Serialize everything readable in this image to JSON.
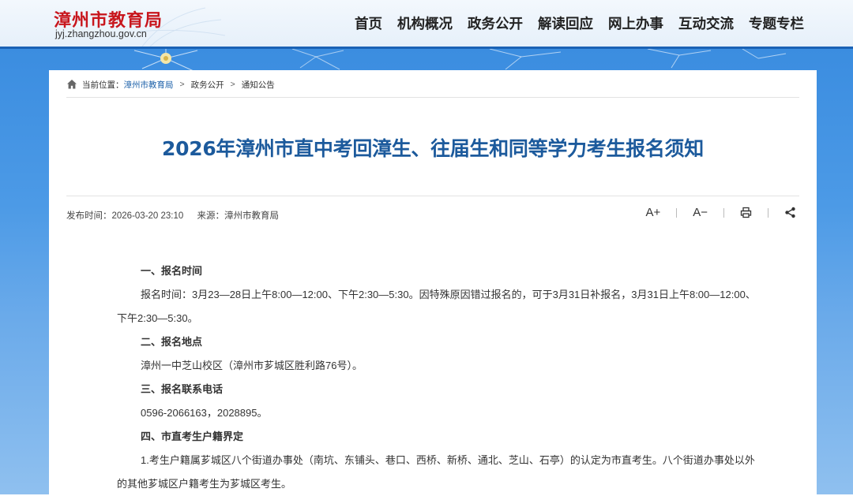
{
  "header": {
    "logo_cn": "漳州市教育局",
    "logo_url": "jyj.zhangzhou.gov.cn",
    "nav": [
      "首页",
      "机构概况",
      "政务公开",
      "解读回应",
      "网上办事",
      "互动交流",
      "专题专栏"
    ]
  },
  "breadcrumb": {
    "prefix": "当前位置：",
    "items": [
      "漳州市教育局",
      "政务公开",
      "通知公告"
    ],
    "sep": ">"
  },
  "article": {
    "title": "2026年漳州市直中考回漳生、往届生和同等学力考生报名须知",
    "publish_time": "发布时间：2026-03-20 23:10",
    "source": "来源：漳州市教育局",
    "tools": {
      "font_up": "A+",
      "font_down": "A−"
    },
    "paragraphs": [
      {
        "type": "heading",
        "text": "一、报名时间"
      },
      {
        "type": "text",
        "text": "报名时间：3月23—28日上午8:00—12:00、下午2:30—5:30。因特殊原因错过报名的，可于3月31日补报名，3月31日上午8:00—12:00、下午2:30—5:30。"
      },
      {
        "type": "heading",
        "text": "二、报名地点"
      },
      {
        "type": "text",
        "text": "漳州一中芝山校区（漳州市芗城区胜利路76号）。"
      },
      {
        "type": "heading",
        "text": "三、报名联系电话"
      },
      {
        "type": "text",
        "text": "0596-2066163，2028895。"
      },
      {
        "type": "heading",
        "text": "四、市直考生户籍界定"
      },
      {
        "type": "text",
        "text": "1.考生户籍属芗城区八个街道办事处（南坑、东铺头、巷口、西桥、新桥、通北、芝山、石亭）的认定为市直考生。八个街道办事处以外的其他芗城区户籍考生为芗城区考生。"
      }
    ]
  },
  "colors": {
    "accent": "#1c5a9c",
    "logo_red": "#c8161d",
    "banner_blue": "#4c9ae6"
  },
  "icons": [
    "home-icon",
    "print-icon",
    "share-icon",
    "flower-decoration"
  ]
}
